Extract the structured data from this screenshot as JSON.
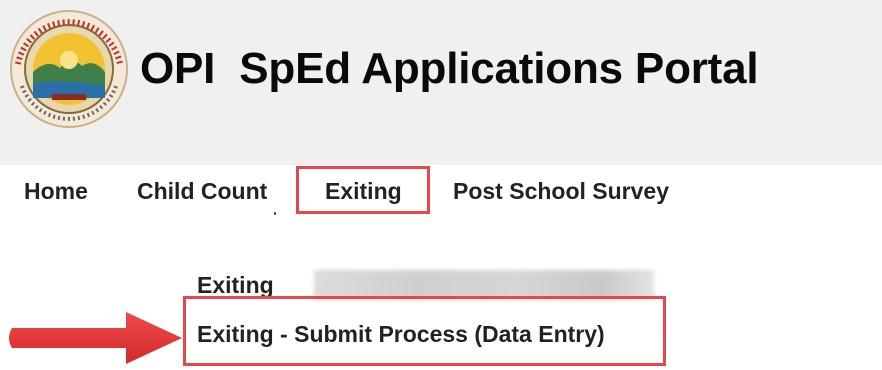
{
  "header": {
    "title": "OPI  SpEd Applications Portal",
    "logo_icon": "opi-state-seal-icon"
  },
  "nav": {
    "items": [
      {
        "label": "Home"
      },
      {
        "label": "Child Count"
      },
      {
        "label": "Exiting"
      },
      {
        "label": "Post School Survey"
      }
    ],
    "highlight_color": "#e5484b"
  },
  "submenu": {
    "items": [
      {
        "label": "Exiting"
      },
      {
        "label": "Exiting - Submit Process (Data Entry)"
      }
    ],
    "highlight_color": "#e5484b",
    "pointer_icon": "red-arrow-icon",
    "arrow_color": "#e0393b"
  }
}
